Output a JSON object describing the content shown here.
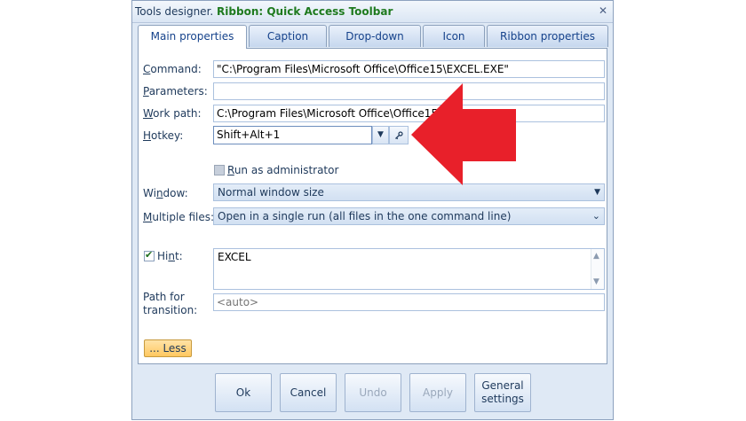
{
  "title": {
    "prefix": "Tools designer.",
    "main": "Ribbon: Quick Access Toolbar"
  },
  "tabs": [
    {
      "label": "Main properties",
      "active": true
    },
    {
      "label": "Caption",
      "active": false
    },
    {
      "label": "Drop-down",
      "active": false
    },
    {
      "label": "Icon",
      "active": false
    },
    {
      "label": "Ribbon properties",
      "active": false
    }
  ],
  "fields": {
    "command": {
      "label_u": "C",
      "label_rest": "ommand:",
      "value": "\"C:\\Program Files\\Microsoft Office\\Office15\\EXCEL.EXE\""
    },
    "parameters": {
      "label_u": "P",
      "label_rest": "arameters:",
      "value": ""
    },
    "work_path": {
      "label_u": "W",
      "label_rest": "ork path:",
      "value": "C:\\Program Files\\Microsoft Office\\Office15\\"
    },
    "hotkey": {
      "label_u": "H",
      "label_rest": "otkey:",
      "value": "Shift+Alt+1"
    },
    "run_as_admin": {
      "label_u": "R",
      "label_rest": "un as administrator",
      "checked": false
    },
    "window": {
      "label_pre": "Wi",
      "label_u": "n",
      "label_rest": "dow:",
      "value": "Normal window size"
    },
    "multiple_files": {
      "label_u": "M",
      "label_rest": "ultiple files:",
      "value": "Open in a single run (all files in the one command line)"
    },
    "hint": {
      "label_pre": "Hi",
      "label_u": "n",
      "label_rest": "t:",
      "checked": true,
      "value": "EXCEL"
    },
    "path_transition": {
      "label_line1": "Path for",
      "label_line2": "transition:",
      "placeholder": "<auto>"
    }
  },
  "less_label": "... Less",
  "footer": {
    "ok": "Ok",
    "cancel": "Cancel",
    "undo": "Undo",
    "apply": "Apply",
    "general_line1": "General",
    "general_line2": "settings"
  },
  "icons": {
    "close": "close-icon",
    "dropdown": "chevron-down-icon",
    "key": "key-icon",
    "annotation": "red-arrow"
  },
  "colors": {
    "title_accent": "#1e7a1e",
    "arrow": "#e8202a",
    "less_button": "#ffc860"
  }
}
